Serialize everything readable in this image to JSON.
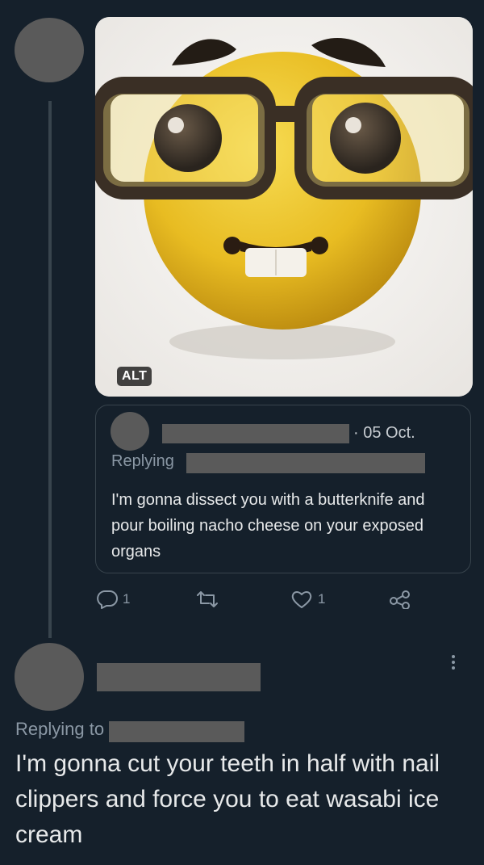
{
  "colors": {
    "background": "#15202b",
    "text": "#e7e9ea",
    "muted": "#8b98a5",
    "border": "#38444d",
    "redaction": "#5a5a5a"
  },
  "main_tweet": {
    "media": {
      "alt_badge": "ALT",
      "subject": "nerd-face-emoji"
    },
    "quote": {
      "date": "· 05 Oct.",
      "replying_label": "Replying",
      "text": "I'm gonna dissect you with a butterknife and pour boiling nacho cheese on your exposed organs"
    },
    "actions": {
      "reply_icon": "reply-icon",
      "reply_count": "1",
      "retweet_icon": "retweet-icon",
      "like_icon": "heart-icon",
      "like_count": "1",
      "share_icon": "share-icon"
    }
  },
  "reply_tweet": {
    "more_icon": "more-icon",
    "replying_label": "Replying to",
    "text": "I'm gonna cut your teeth in half with nail clippers and force you to eat wasabi ice cream"
  }
}
